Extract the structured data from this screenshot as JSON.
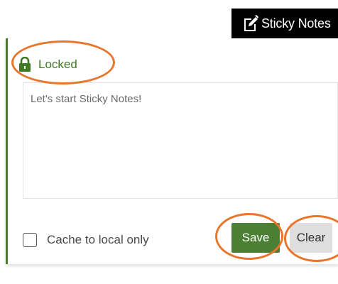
{
  "app": {
    "tab_label": "Sticky Notes",
    "tab_icon": "note-pencil-icon"
  },
  "lock": {
    "icon": "lock-icon",
    "label": "Locked",
    "color": "#3f7a22"
  },
  "note": {
    "placeholder": "Let's start Sticky Notes!",
    "value": ""
  },
  "cache": {
    "label": "Cache to local only",
    "checked": false
  },
  "buttons": {
    "save_label": "Save",
    "clear_label": "Clear"
  },
  "colors": {
    "accent": "#4b7f34",
    "annotation": "#e8762c",
    "tab_bg": "#000000"
  }
}
